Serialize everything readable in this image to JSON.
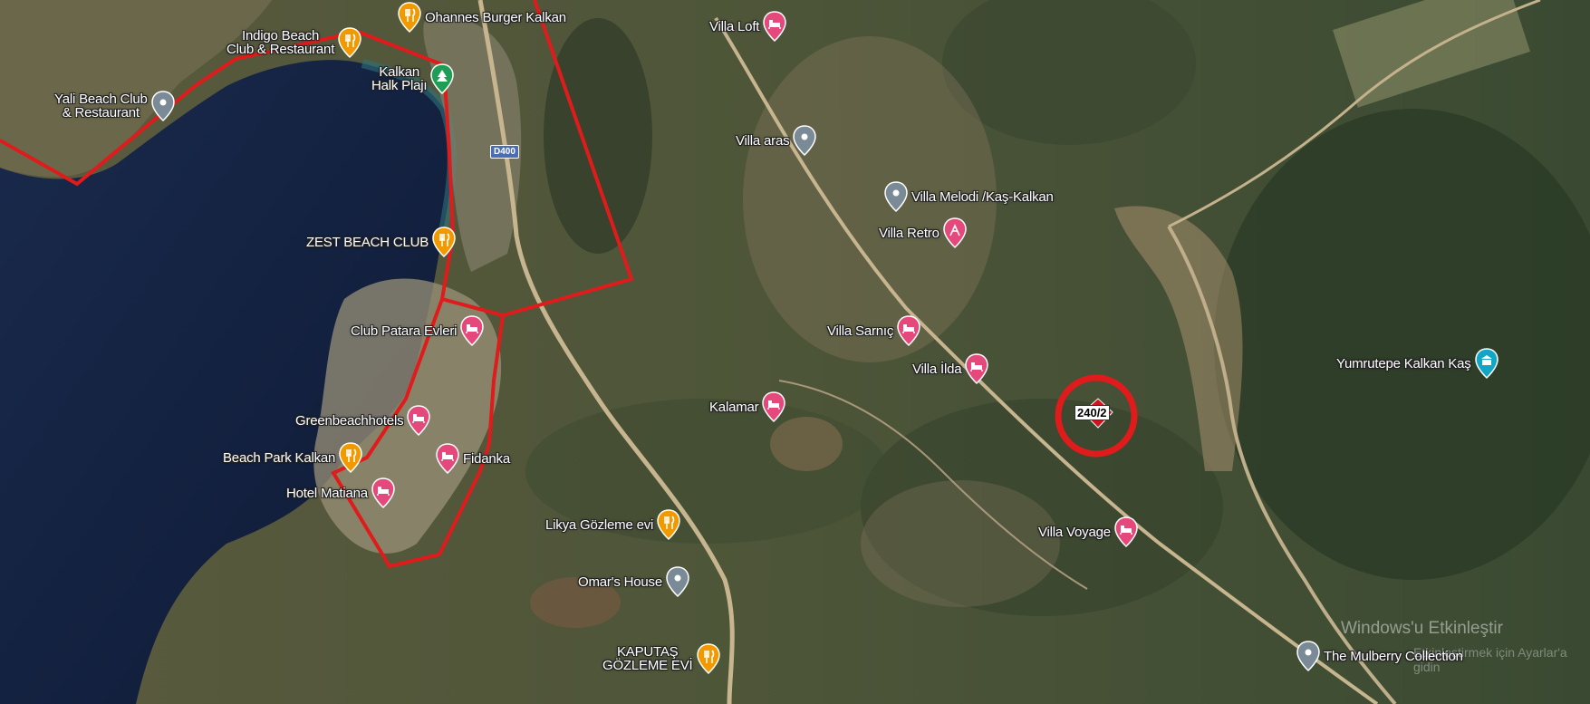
{
  "map": {
    "type": "satellite",
    "parcel_label": "240/2",
    "road_label": "D400",
    "overlay_color": "#e01b1b",
    "parcel_marker_color": "#d0131e",
    "watermark_line1": "Windows'u Etkinleştir",
    "watermark_line2": "Etkinleştirmek için Ayarlar'a gidin"
  },
  "pois": [
    {
      "label": "Indigo Beach\nClub & Restaurant",
      "type": "food",
      "icon": "fork-knife-icon"
    },
    {
      "label": "Ohannes Burger Kalkan",
      "type": "food",
      "icon": "fork-knife-icon"
    },
    {
      "label": "Kalkan\nHalk Plajı",
      "type": "park",
      "icon": "tree-icon"
    },
    {
      "label": "Yali Beach Club\n& Restaurant",
      "type": "place",
      "icon": "location-pin-icon"
    },
    {
      "label": "ZEST BEACH CLUB",
      "type": "food",
      "icon": "fork-knife-icon"
    },
    {
      "label": "Club Patara Evleri",
      "type": "hotel",
      "icon": "bed-icon"
    },
    {
      "label": "Greenbeachhotels",
      "type": "hotel",
      "icon": "bed-icon"
    },
    {
      "label": "Beach Park Kalkan",
      "type": "food",
      "icon": "fork-knife-icon"
    },
    {
      "label": "Fidanka",
      "type": "hotel",
      "icon": "bed-icon"
    },
    {
      "label": "Hotel Matiana",
      "type": "hotel",
      "icon": "bed-icon"
    },
    {
      "label": "Villa Loft",
      "type": "hotel",
      "icon": "bed-icon"
    },
    {
      "label": "Villa aras",
      "type": "place",
      "icon": "location-pin-icon"
    },
    {
      "label": "Villa Melodi /Kaş-Kalkan",
      "type": "place",
      "icon": "location-pin-icon"
    },
    {
      "label": "Villa Retro",
      "type": "activity",
      "icon": "hiking-icon"
    },
    {
      "label": "Villa Sarnıç",
      "type": "hotel",
      "icon": "bed-icon"
    },
    {
      "label": "Villa İlda",
      "type": "hotel",
      "icon": "bed-icon"
    },
    {
      "label": "Kalamar",
      "type": "hotel",
      "icon": "bed-icon"
    },
    {
      "label": "Likya Gözleme evi",
      "type": "food",
      "icon": "fork-knife-icon"
    },
    {
      "label": "Omar's House",
      "type": "place",
      "icon": "location-pin-icon"
    },
    {
      "label": "KAPUTAŞ\nGÖZLEME EVİ",
      "type": "food",
      "icon": "fork-knife-icon"
    },
    {
      "label": "Villa Voyage",
      "type": "hotel",
      "icon": "bed-icon"
    },
    {
      "label": "Yumrutepe Kalkan Kaş",
      "type": "landmark",
      "icon": "landmark-icon"
    },
    {
      "label": "The Mulberry Collection",
      "type": "place",
      "icon": "location-pin-icon"
    }
  ]
}
